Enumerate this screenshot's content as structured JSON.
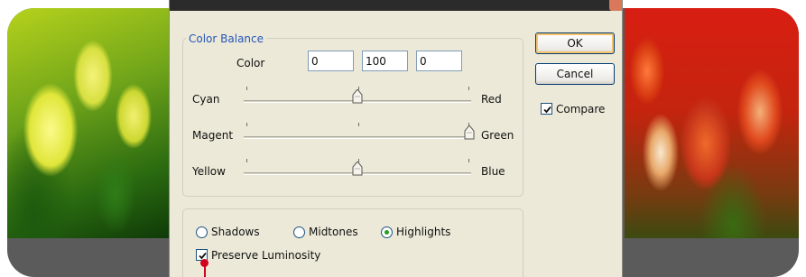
{
  "dialog": {
    "group_title": "Color Balance",
    "color_label": "Color",
    "color_levels": [
      "0",
      "100",
      "0"
    ],
    "sliders": [
      {
        "left": "Cyan",
        "right": "Red",
        "value": 0,
        "min": -100,
        "max": 100
      },
      {
        "left": "Magenta",
        "right": "Green",
        "value": 100,
        "min": -100,
        "max": 100
      },
      {
        "left": "Yellow",
        "right": "Blue",
        "value": 0,
        "min": -100,
        "max": 100
      }
    ],
    "tone": {
      "shadows": "Shadows",
      "midtones": "Midtones",
      "highlights": "Highlights",
      "selected": "Highlights"
    },
    "preserve_luminosity": {
      "label": "Preserve Luminosity",
      "checked": true
    }
  },
  "buttons": {
    "ok": "OK",
    "cancel": "Cancel"
  },
  "compare": {
    "label": "Compare",
    "checked": true
  },
  "colors": {
    "accent_blue": "#2455b8",
    "cursor_red": "#d0021b",
    "dialog_bg": "#ece9d8"
  }
}
